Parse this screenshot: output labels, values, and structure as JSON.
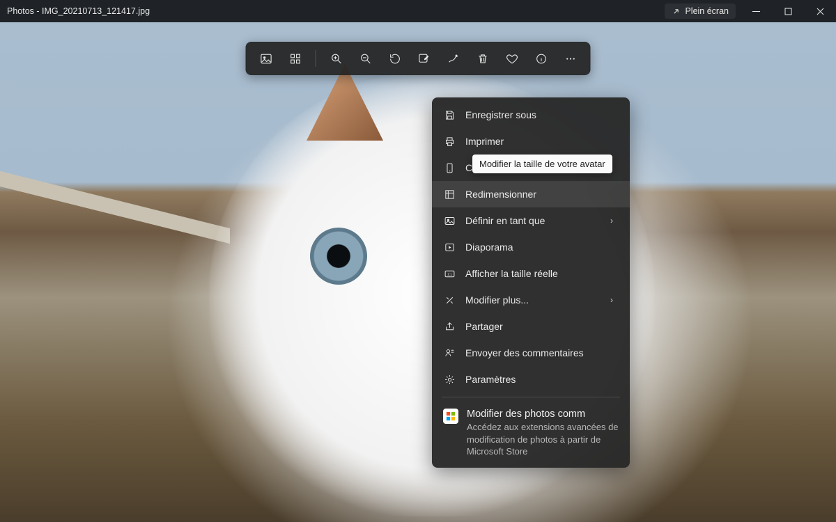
{
  "titlebar": {
    "title": "Photos - IMG_20210713_121417.jpg",
    "fullscreen_label": "Plein écran"
  },
  "tooltip": {
    "text": "Modifier la taille de votre avatar"
  },
  "menu": {
    "items": [
      {
        "label": "Enregistrer sous",
        "icon": "save",
        "submenu": false
      },
      {
        "label": "Imprimer",
        "icon": "print",
        "submenu": false
      },
      {
        "label": "Copier vers le Presse-papier",
        "icon": "phone",
        "submenu": false
      },
      {
        "label": "Redimensionner",
        "icon": "resize",
        "submenu": false
      },
      {
        "label": "Définir en tant que",
        "icon": "setas",
        "submenu": true
      },
      {
        "label": "Diaporama",
        "icon": "play",
        "submenu": false
      },
      {
        "label": "Afficher la taille réelle",
        "icon": "onetoone",
        "submenu": false
      },
      {
        "label": "Modifier plus...",
        "icon": "tools",
        "submenu": true
      },
      {
        "label": "Partager",
        "icon": "share",
        "submenu": false
      },
      {
        "label": "Envoyer des commentaires",
        "icon": "feedback",
        "submenu": false
      },
      {
        "label": "Paramètres",
        "icon": "settings",
        "submenu": false
      }
    ],
    "promo": {
      "title": "Modifier des photos comm",
      "desc": "Accédez aux extensions avancées de modification de photos à partir de Microsoft Store"
    }
  }
}
